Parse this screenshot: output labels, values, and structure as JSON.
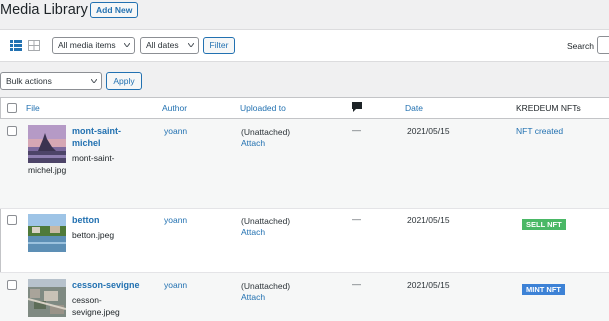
{
  "header": {
    "title": "Media Library",
    "add_new": "Add New"
  },
  "filters": {
    "media_type": "All media items",
    "dates": "All dates",
    "filter_button": "Filter",
    "search_label": "Search"
  },
  "bulk": {
    "action": "Bulk actions",
    "apply": "Apply"
  },
  "columns": {
    "file": "File",
    "author": "Author",
    "uploaded_to": "Uploaded to",
    "comments_icon": "comment-bubble-icon",
    "date": "Date",
    "kredeum": "KREDEUM NFTs"
  },
  "rows": [
    {
      "title_lines": [
        "mont-saint-",
        "michel"
      ],
      "file_lines": [
        "mont-saint-",
        "michel.jpg"
      ],
      "author": "yoann",
      "uploaded": "(Unattached)",
      "attach": "Attach",
      "comments": "—",
      "date": "2021/05/15",
      "nft": "NFT created"
    },
    {
      "title_lines": [
        "betton"
      ],
      "file_lines": [
        "betton.jpeg"
      ],
      "author": "yoann",
      "uploaded": "(Unattached)",
      "attach": "Attach",
      "comments": "—",
      "date": "2021/05/15",
      "nft": "SELL NFT"
    },
    {
      "title_lines": [
        "cesson-sevigne"
      ],
      "file_lines": [
        "cesson-",
        "sevigne.jpeg"
      ],
      "author": "yoann",
      "uploaded": "(Unattached)",
      "attach": "Attach",
      "comments": "—",
      "date": "2021/05/15",
      "nft": "MINT NFT"
    }
  ],
  "colors": {
    "link": "#2271b1",
    "sell_badge": "#4ab866",
    "mint_badge": "#3d82d6"
  }
}
